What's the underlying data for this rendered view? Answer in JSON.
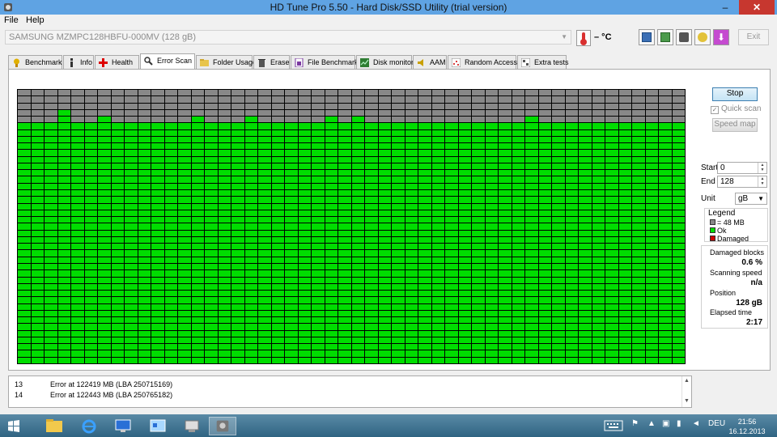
{
  "window": {
    "title": "HD Tune Pro 5.50 - Hard Disk/SSD Utility (trial version)"
  },
  "menu": {
    "file": "File",
    "help": "Help"
  },
  "toolbar": {
    "drive": "SAMSUNG MZMPC128HBFU-000MV (128 gB)",
    "temperature": "– °C",
    "exit_label": "Exit",
    "icons": [
      "copy-info-icon",
      "copy-screen-icon",
      "screenshot-camera-icon",
      "options-key-icon",
      "save-download-icon"
    ]
  },
  "tabs": [
    {
      "label": "Benchmark",
      "icon": "benchmark-icon"
    },
    {
      "label": "Info",
      "icon": "info-icon"
    },
    {
      "label": "Health",
      "icon": "health-cross-icon"
    },
    {
      "label": "Error Scan",
      "icon": "magnifier-icon",
      "active": true
    },
    {
      "label": "Folder Usage",
      "icon": "folder-icon"
    },
    {
      "label": "Erase",
      "icon": "trash-icon"
    },
    {
      "label": "File Benchmark",
      "icon": "file-benchmark-icon"
    },
    {
      "label": "Disk monitor",
      "icon": "disk-monitor-icon"
    },
    {
      "label": "AAM",
      "icon": "speaker-icon"
    },
    {
      "label": "Random Access",
      "icon": "random-access-icon"
    },
    {
      "label": "Extra tests",
      "icon": "extra-tests-icon"
    }
  ],
  "controls": {
    "stop_label": "Stop",
    "quick_scan_label": "Quick scan",
    "quick_scan_checked": true,
    "speed_map_label": "Speed map",
    "start_label": "Start",
    "start_value": "0",
    "end_label": "End",
    "end_value": "128",
    "unit_label": "Unit",
    "unit_value": "gB"
  },
  "legend": {
    "title": "Legend",
    "items": [
      {
        "label": "= 48 MB",
        "color": "#888888"
      },
      {
        "label": "Ok",
        "color": "#00dd00"
      },
      {
        "label": "Damaged",
        "color": "#cc0000"
      }
    ]
  },
  "stats": {
    "damaged_blocks_label": "Damaged blocks",
    "damaged_blocks_value": "0.6 %",
    "scanning_speed_label": "Scanning speed",
    "scanning_speed_value": "n/a",
    "position_label": "Position",
    "position_value": "128 gB",
    "elapsed_label": "Elapsed time",
    "elapsed_value": "2:17"
  },
  "blockmap": {
    "columns": 50,
    "rows": 41,
    "unscanned_color": "#888888",
    "ok_color": "#00dd00",
    "unscanned_rows_per_column": [
      5,
      5,
      5,
      3,
      5,
      5,
      4,
      5,
      5,
      5,
      5,
      5,
      5,
      4,
      5,
      5,
      5,
      4,
      5,
      5,
      5,
      5,
      5,
      4,
      5,
      4,
      5,
      5,
      5,
      5,
      5,
      5,
      5,
      5,
      5,
      5,
      5,
      5,
      4,
      5,
      5,
      5,
      5,
      5,
      5,
      5,
      5,
      5,
      5,
      5
    ]
  },
  "log": [
    {
      "num": "13",
      "msg": "Error at 122419 MB (LBA 250715169)"
    },
    {
      "num": "14",
      "msg": "Error at 122443 MB (LBA 250765182)"
    }
  ],
  "taskbar": {
    "apps": [
      "start-windows-icon",
      "file-explorer-icon",
      "internet-explorer-icon",
      "remote-desktop-icon",
      "control-panel-icon",
      "network-icon",
      "hdtune-icon"
    ],
    "language": "DEU",
    "time": "21:56",
    "date": "16.12.2013"
  }
}
